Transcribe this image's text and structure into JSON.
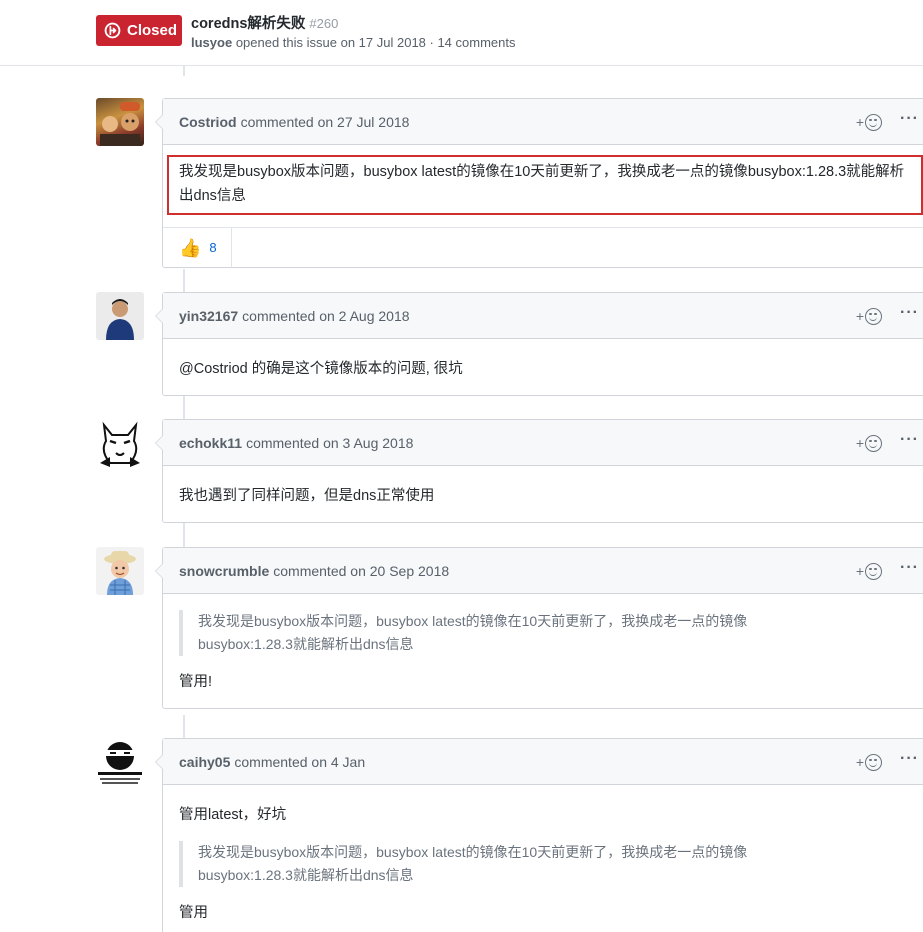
{
  "issue": {
    "state": "Closed",
    "title": "coredns解析失败",
    "number": "#260",
    "author": "lusyoe",
    "meta_text": "opened this issue on 17 Jul 2018 · 14 comments"
  },
  "comments": [
    {
      "author": "Costriod",
      "action": "commented on 27 Jul 2018",
      "body": "我发现是busybox版本问题，busybox latest的镜像在10天前更新了，我换成老一点的镜像busybox:1.28.3就能解析出dns信息",
      "reaction_emoji": "👍",
      "reaction_count": "8"
    },
    {
      "author": "yin32167",
      "action": "commented on 2 Aug 2018",
      "body": "@Costriod 的确是这个镜像版本的问题, 很坑"
    },
    {
      "author": "echokk11",
      "action": "commented on 3 Aug 2018",
      "body": "我也遇到了同样问题，但是dns正常使用"
    },
    {
      "author": "snowcrumble",
      "action": "commented on 20 Sep 2018",
      "quote": "我发现是busybox版本问题，busybox latest的镜像在10天前更新了，我换成老一点的镜像busybox:1.28.3就能解析出dns信息",
      "body": "管用!"
    },
    {
      "author": "caihy05",
      "action": "commented on 4 Jan",
      "body_top": "管用latest，好坑",
      "quote": "我发现是busybox版本问题，busybox latest的镜像在10天前更新了，我换成老一点的镜像busybox:1.28.3就能解析出dns信息",
      "body": "管用"
    }
  ],
  "actions": {
    "add_reaction": "+",
    "more": "···"
  },
  "colors": {
    "closed_badge": "#cb2431",
    "highlight_border": "#d12e2e",
    "link": "#0366d6"
  }
}
